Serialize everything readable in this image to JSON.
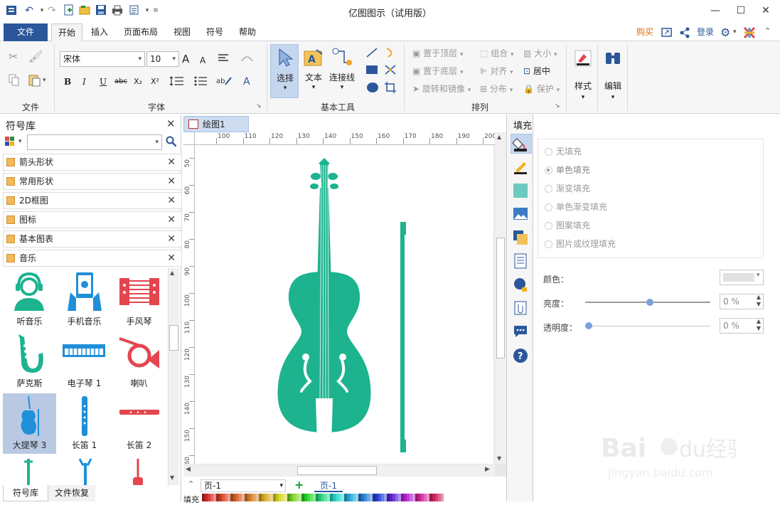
{
  "app": {
    "title": "亿图图示（试用版）"
  },
  "window_controls": {
    "minimize": "—",
    "maximize": "☐",
    "close": "✕"
  },
  "menu": {
    "tabs": [
      "文件",
      "开始",
      "插入",
      "页面布局",
      "视图",
      "符号",
      "帮助"
    ],
    "right": {
      "buy": "购买",
      "login": "登录"
    }
  },
  "ribbon": {
    "file_group": {
      "label": "文件"
    },
    "font_group": {
      "label": "字体",
      "font_name": "宋体",
      "font_size": "10",
      "bold": "B",
      "italic": "I",
      "underline": "U",
      "strike": "abc",
      "sub": "X₂",
      "sup": "X²",
      "grow": "A",
      "shrink": "A",
      "color_a": "A"
    },
    "tools_group": {
      "label": "基本工具",
      "select": "选择",
      "text": "文本",
      "connector": "连接线"
    },
    "arrange_group": {
      "label": "排列",
      "bring_front": "置于顶层",
      "send_back": "置于底层",
      "rotate": "旋转和镜像",
      "group": "组合",
      "align": "对齐",
      "distribute": "分布",
      "size": "大小",
      "center": "居中",
      "protect": "保护"
    },
    "style": "样式",
    "edit": "编辑"
  },
  "left_panel": {
    "title": "符号库",
    "libraries": [
      "箭头形状",
      "常用形状",
      "2D框图",
      "图标",
      "基本图表",
      "音乐"
    ],
    "symbols": [
      {
        "label": "听音乐"
      },
      {
        "label": "手机音乐"
      },
      {
        "label": "手风琴"
      },
      {
        "label": "萨克斯"
      },
      {
        "label": "电子琴 1"
      },
      {
        "label": "喇叭"
      },
      {
        "label": "大提琴 3"
      },
      {
        "label": "长笛 1"
      },
      {
        "label": "长笛 2"
      }
    ],
    "bottom_tabs": [
      "符号库",
      "文件恢复"
    ]
  },
  "document": {
    "tab": "绘图1",
    "ruler_h": [
      "100",
      "110",
      "120",
      "130",
      "140",
      "150",
      "160",
      "170",
      "180",
      "190",
      "200"
    ],
    "ruler_v": [
      "50",
      "60",
      "70",
      "80",
      "90",
      "100",
      "110",
      "120",
      "130",
      "140",
      "150",
      "160"
    ]
  },
  "status": {
    "page_select": "页-1",
    "page_tab": "页-1",
    "fill_label": "填充"
  },
  "fill_panel": {
    "title": "填充",
    "options": [
      "无填充",
      "单色填充",
      "渐变填充",
      "单色渐变填充",
      "图案填充",
      "图片或纹理填充"
    ],
    "selected": "单色填充",
    "color_label": "颜色：",
    "brightness_label": "亮度：",
    "brightness_value": "0 %",
    "transparency_label": "透明度：",
    "transparency_value": "0 %"
  },
  "colors": {
    "accent": "#2b579a",
    "cello": "#1db38e",
    "buy": "#e06c00",
    "symbol_blue": "#1f8fd8",
    "symbol_red": "#e4454e"
  }
}
